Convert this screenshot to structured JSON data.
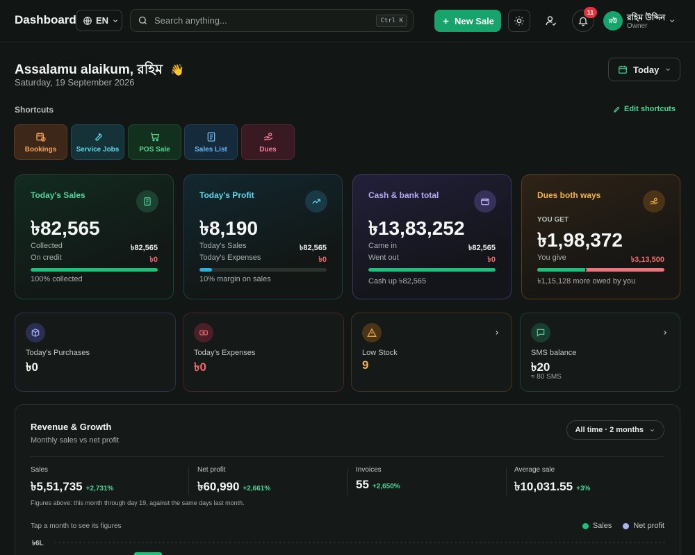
{
  "header": {
    "brand": "Dashboard",
    "language": "EN",
    "search_placeholder": "Search anything...",
    "search_shortcut": "Ctrl K",
    "new_sale_label": "New Sale",
    "notification_count": "11",
    "user": {
      "initials": "রউ",
      "name": "রহিম উদ্দিন",
      "role": "Owner"
    }
  },
  "greeting": {
    "text": "Assalamu alaikum, রহিম",
    "emoji": "👋",
    "date": "Saturday, 19 September 2026",
    "period": "Today"
  },
  "shortcuts": {
    "title": "Shortcuts",
    "edit_label": "Edit shortcuts",
    "items": [
      {
        "label": "Bookings",
        "icon": "calendar-clock-icon"
      },
      {
        "label": "Service Jobs",
        "icon": "wrench-icon"
      },
      {
        "label": "POS Sale",
        "icon": "cart-icon"
      },
      {
        "label": "Sales List",
        "icon": "receipt-list-icon"
      },
      {
        "label": "Dues",
        "icon": "hand-coins-icon"
      }
    ]
  },
  "cards": {
    "sales": {
      "title": "Today's Sales",
      "value": "৳82,565",
      "row1_label": "Collected",
      "row1_value": "৳82,565",
      "row2_label": "On credit",
      "row2_value": "৳0",
      "progress": 1.0,
      "footer": "100% collected"
    },
    "profit": {
      "title": "Today's Profit",
      "value": "৳8,190",
      "row1_label": "Today's Sales",
      "row1_value": "৳82,565",
      "row2_label": "Today's Expenses",
      "row2_value": "৳0",
      "progress": 0.1,
      "footer": "10% margin on sales"
    },
    "cash": {
      "title": "Cash & bank total",
      "value": "৳13,83,252",
      "row1_label": "Came in",
      "row1_value": "৳82,565",
      "row2_label": "Went out",
      "row2_value": "৳0",
      "progress": 1.0,
      "footer": "Cash up ৳82,565"
    },
    "dues": {
      "title": "Dues both ways",
      "you_get_label": "YOU GET",
      "value": "৳1,98,372",
      "you_give_label": "You give",
      "you_give_value": "৳3,13,500",
      "get_share": 0.388,
      "footer": "৳1,15,128 more owed by you"
    }
  },
  "mini_cards": {
    "purchases": {
      "label": "Today's Purchases",
      "value": "৳0"
    },
    "expenses": {
      "label": "Today's Expenses",
      "value": "৳0"
    },
    "stock": {
      "label": "Low Stock",
      "value": "9"
    },
    "sms": {
      "label": "SMS balance",
      "value": "৳20",
      "sub": "≈ 80 SMS"
    }
  },
  "revenue": {
    "title": "Revenue & Growth",
    "subtitle": "Monthly sales vs net profit",
    "range": "All time · 2 months",
    "kpis": [
      {
        "label": "Sales",
        "value": "৳5,51,735",
        "change": "+2,731%"
      },
      {
        "label": "Net profit",
        "value": "৳60,990",
        "change": "+2,661%"
      },
      {
        "label": "Invoices",
        "value": "55",
        "change": "+2,650%"
      },
      {
        "label": "Average sale",
        "value": "৳10,031.55",
        "change": "+3%"
      }
    ],
    "note": "Figures above: this month through day 19, against the same days last month.",
    "tap_hint": "Tap a month to see its figures"
  },
  "chart_data": {
    "type": "bar",
    "series": [
      {
        "name": "Sales",
        "color": "#17c27a"
      },
      {
        "name": "Net profit",
        "color": "#a9b4f2"
      }
    ],
    "y_tick_labels": [
      "৳6L"
    ],
    "ylim": [
      0,
      600000
    ],
    "grid": true,
    "legend": "top-right"
  },
  "colors": {
    "accent": "#17a36c",
    "danger": "#f06a6a",
    "warning": "#f4b24a"
  }
}
